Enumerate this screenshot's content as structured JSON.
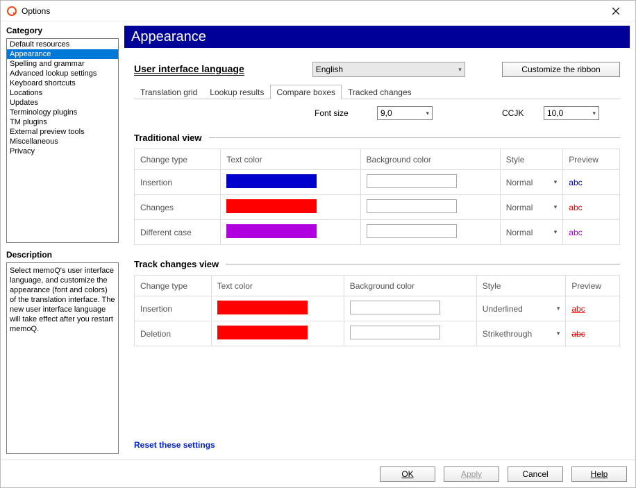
{
  "window": {
    "title": "Options"
  },
  "sidebar": {
    "heading": "Category",
    "items": [
      "Default resources",
      "Appearance",
      "Spelling and grammar",
      "Advanced lookup settings",
      "Keyboard shortcuts",
      "Locations",
      "Updates",
      "Terminology plugins",
      "TM plugins",
      "External preview tools",
      "Miscellaneous",
      "Privacy"
    ],
    "selected_index": 1,
    "description_heading": "Description",
    "description_text": "Select memoQ's user interface language, and customize the appearance (font and colors) of the translation interface. The new user interface language will take effect after you restart memoQ."
  },
  "page": {
    "title": "Appearance",
    "ui_language_label": "User interface language",
    "ui_language_value": "English",
    "customize_ribbon": "Customize the ribbon",
    "tabs": [
      "Translation grid",
      "Lookup results",
      "Compare boxes",
      "Tracked changes"
    ],
    "active_tab_index": 2,
    "font_size_label": "Font size",
    "font_size_value": "9,0",
    "ccjk_label": "CCJK",
    "ccjk_value": "10,0",
    "columns": {
      "change_type": "Change type",
      "text_color": "Text color",
      "background_color": "Background color",
      "style": "Style",
      "preview": "Preview"
    },
    "traditional": {
      "heading": "Traditional view",
      "rows": [
        {
          "label": "Insertion",
          "text_color": "#0000cc",
          "bg": "#ffffff",
          "style": "Normal",
          "preview_text": "abc",
          "preview_color": "#0000cc"
        },
        {
          "label": "Changes",
          "text_color": "#ff0000",
          "bg": "#ffffff",
          "style": "Normal",
          "preview_text": "abc",
          "preview_color": "#ff0000"
        },
        {
          "label": "Different case",
          "text_color": "#b000e0",
          "bg": "#ffffff",
          "style": "Normal",
          "preview_text": "abc",
          "preview_color": "#b000e0"
        }
      ]
    },
    "track_changes": {
      "heading": "Track changes view",
      "rows": [
        {
          "label": "Insertion",
          "text_color": "#ff0000",
          "bg": "#ffffff",
          "style": "Underlined",
          "preview_text": "abc",
          "preview_color": "#ff0000",
          "decoration": "underline"
        },
        {
          "label": "Deletion",
          "text_color": "#ff0000",
          "bg": "#ffffff",
          "style": "Strikethrough",
          "preview_text": "abc",
          "preview_color": "#ff0000",
          "decoration": "line-through"
        }
      ]
    },
    "reset_link": "Reset these settings"
  },
  "footer": {
    "ok": "OK",
    "apply": "Apply",
    "cancel": "Cancel",
    "help": "Help"
  }
}
